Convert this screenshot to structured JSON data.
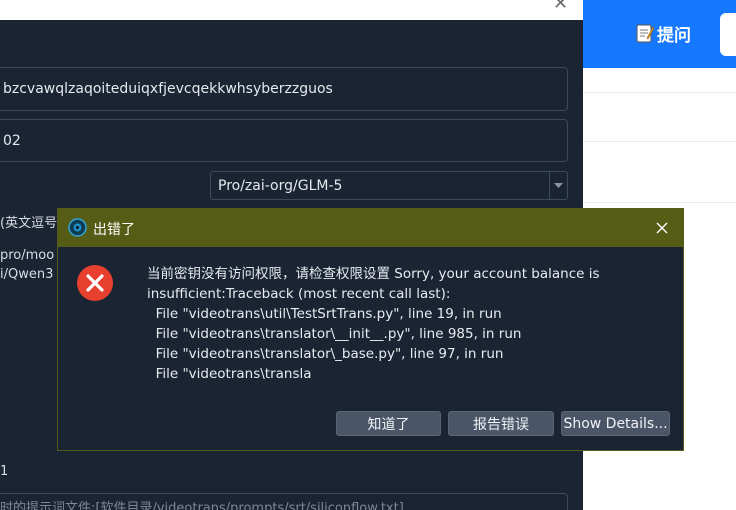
{
  "background_window": {
    "api_key_value": "bzcvawqlzaqoiteduiqxfjevcqekkwhsyberzzguos",
    "number_field_value": "02",
    "model_select_value": "Pro/zai-org/GLM-5",
    "label_text_1": "(英文逗号",
    "label_text_2": "pro/moo",
    "label_text_3": "i/Qwen3",
    "label_text_4": "1",
    "prompt_hint": "时的提示词文件:[软件目录/videotrans/prompts/srt/siliconflow.txt]"
  },
  "right_page": {
    "ask_label": "提问"
  },
  "error_dialog": {
    "title": "出错了",
    "message": "当前密钥没有访问权限，请检查权限设置 Sorry, your account balance is\ninsufficient:Traceback (most recent call last):\n  File \"videotrans\\util\\TestSrtTrans.py\", line 19, in run\n  File \"videotrans\\translator\\__init__.py\", line 985, in run\n  File \"videotrans\\translator\\_base.py\", line 97, in run\n  File \"videotrans\\transla",
    "buttons": {
      "ok": "知道了",
      "report": "报告错误",
      "details": "Show Details..."
    }
  },
  "colors": {
    "dialog_titlebar": "#545c16",
    "dialog_bg": "#1b2433",
    "accent_blue": "#1677ff",
    "error_red": "#e8402f"
  }
}
